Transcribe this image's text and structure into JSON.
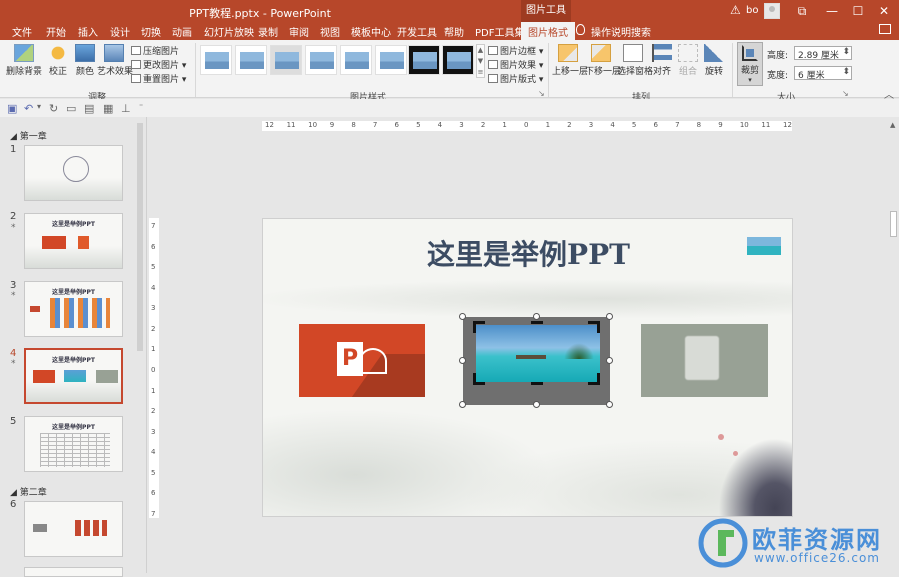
{
  "titlebar": {
    "title": "PPT教程.pptx  -  PowerPoint",
    "context_tab": "图片工具",
    "user": "bo",
    "btn_restore": "⧉",
    "btn_min": "—",
    "btn_max": "☐",
    "btn_close": "✕"
  },
  "tabs": [
    "文件",
    "开始",
    "插入",
    "设计",
    "切换",
    "动画",
    "幻灯片放映",
    "录制",
    "审阅",
    "视图",
    "模板中心",
    "开发工具",
    "帮助",
    "PDF工具集",
    "图片格式"
  ],
  "active_tab": "图片格式",
  "help_search": "操作说明搜索",
  "ribbon": {
    "adjust": {
      "remove_bg": "删除背景",
      "correct": "校正",
      "color": "颜色",
      "art": "艺术效果",
      "compress": "压缩图片",
      "change": "更改图片",
      "reset": "重置图片",
      "group_label": "调整"
    },
    "styles": {
      "border": "图片边框",
      "effect": "图片效果",
      "layout": "图片版式",
      "group_label": "图片样式"
    },
    "arrange": {
      "bring_forward": "上移一层",
      "send_backward": "下移一层",
      "selection_pane": "选择窗格",
      "align": "对齐",
      "group": "组合",
      "rotate": "旋转",
      "group_label": "排列"
    },
    "size": {
      "crop": "裁剪",
      "height_label": "高度:",
      "height_value": "2.89 厘米",
      "width_label": "宽度:",
      "width_value": "6 厘米",
      "group_label": "大小"
    }
  },
  "left_panel": {
    "section1": "第一章",
    "section2": "第二章",
    "slides": [
      {
        "num": "1",
        "star": "",
        "title": ""
      },
      {
        "num": "2",
        "star": "*",
        "title": "这里是举例PPT"
      },
      {
        "num": "3",
        "star": "*",
        "title": "这里是举例PPT"
      },
      {
        "num": "4",
        "star": "*",
        "title": "这里是举例PPT"
      },
      {
        "num": "5",
        "star": "",
        "title": "这里是举例PPT"
      },
      {
        "num": "6",
        "star": "",
        "title": ""
      }
    ]
  },
  "rulers": {
    "h": [
      "12",
      "11",
      "10",
      "9",
      "8",
      "7",
      "6",
      "5",
      "4",
      "3",
      "2",
      "1",
      "0",
      "1",
      "2",
      "3",
      "4",
      "5",
      "6",
      "7",
      "8",
      "9",
      "10",
      "11",
      "12"
    ],
    "v": [
      "7",
      "6",
      "5",
      "4",
      "3",
      "2",
      "1",
      "0",
      "1",
      "2",
      "3",
      "4",
      "5",
      "6",
      "7"
    ]
  },
  "slide": {
    "title": "这里是举例PPT"
  },
  "watermark": {
    "brand": "欧菲资源网",
    "site": "www.office26.com"
  },
  "colors": {
    "accent": "#b7472a",
    "ppt_orange": "#d24726",
    "title_text": "#3c4c63"
  }
}
